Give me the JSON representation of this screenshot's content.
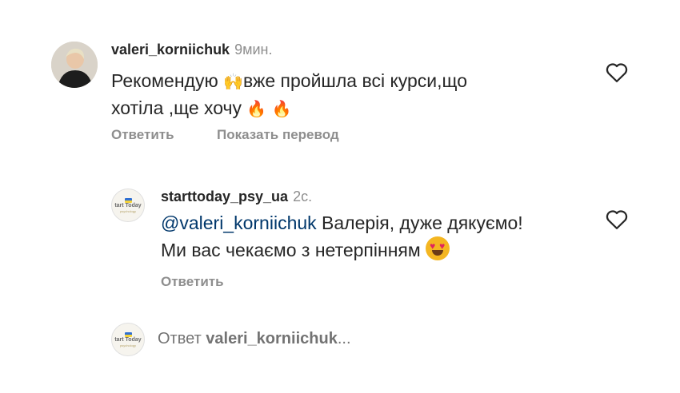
{
  "comment1": {
    "username": "valeri_korniichuk",
    "time": "9мин.",
    "text_part1": "Рекомендую ",
    "text_part2": "вже пройшла всі курси,що",
    "text_line2": "хотіла ,ще хочу ",
    "emoji_raised_hands": "🙌",
    "emoji_fire": "🔥",
    "reply_label": "Ответить",
    "translate_label": "Показать перевод"
  },
  "comment2": {
    "username": "starttoday_psy_ua",
    "time": "2с.",
    "mention": "@valeri_korniichuk",
    "text_part1": " Валерія, дуже дякуємо!",
    "text_line2": "Ми вас чекаємо з нетерпінням ",
    "reply_label": "Ответить"
  },
  "avatar_brand": {
    "text": "tart Today",
    "subtext": "psychology"
  },
  "reply_bar": {
    "prefix": "Ответ ",
    "username": "valeri_korniichuk",
    "suffix": "..."
  },
  "colors": {
    "text": "#262626",
    "muted": "#8e8e8e",
    "mention": "#00376b"
  }
}
